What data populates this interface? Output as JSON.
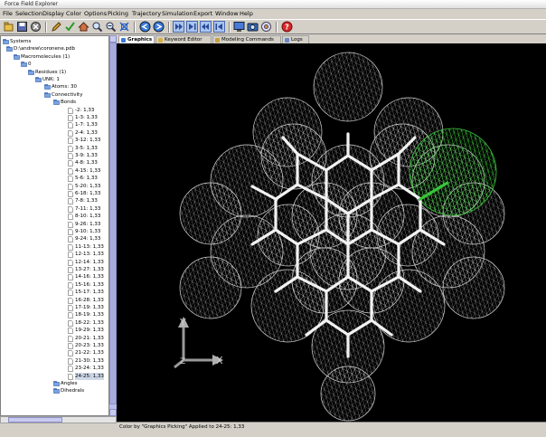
{
  "window": {
    "title": "Force Field Explorer"
  },
  "menu": [
    "File",
    "Selection",
    "Display",
    "Color",
    "Options",
    "Picking",
    "Trajectory",
    "Simulation",
    "Export",
    "Window",
    "Help"
  ],
  "tabs": [
    {
      "label": "Graphics",
      "active": true
    },
    {
      "label": "Keyword Editor",
      "active": false
    },
    {
      "label": "Modeling Commands",
      "active": false
    },
    {
      "label": "Logs",
      "active": false
    }
  ],
  "tree": {
    "systems": "Systems",
    "file": "D:\\andrew\\coronene.pdb",
    "macromolecules": "Macromolecules (1)",
    "chain": "0",
    "residues": "Residues (1)",
    "residue": "UNK: 1",
    "atoms": "Atoms: 30",
    "connectivity": "Connectivity",
    "bonds_label": "Bonds",
    "bonds": [
      "-2: 1,33",
      "1-3: 1,33",
      "1-7: 1,33",
      "2-4: 1,33",
      "3-12: 1,33",
      "3-5: 1,33",
      "3-9: 1,33",
      "4-8: 1,33",
      "4-15: 1,33",
      "5-6: 1,33",
      "5-20: 1,33",
      "6-18: 1,33",
      "7-8: 1,33",
      "7-11: 1,33",
      "8-10: 1,33",
      "9-26: 1,33",
      "9-10: 1,33",
      "9-24: 1,33",
      "11-13: 1,33",
      "12-13: 1,33",
      "12-14: 1,33",
      "13-27: 1,33",
      "14-16: 1,33",
      "15-16: 1,33",
      "15-17: 1,33",
      "16-28: 1,33",
      "17-19: 1,33",
      "18-19: 1,33",
      "18-22: 1,33",
      "19-29: 1,33",
      "20-21: 1,33",
      "20-23: 1,33",
      "21-22: 1,33",
      "21-30: 1,33",
      "23-24: 1,33",
      "24-25: 1,33"
    ],
    "selected_bond": "24-25: 1,33",
    "angles": "Angles",
    "dihedrals": "Dihedrals"
  },
  "axes": {
    "y": "Y",
    "x": "X",
    "z": "Z"
  },
  "status": "Color by \"Graphics Picking\" Applied to 24-25: 1,33",
  "colors": {
    "sphere": "#d6d6d6",
    "bond": "#f2f2f2",
    "picked": "#39c439",
    "background": "#000000",
    "scroll": "#b8bce8"
  }
}
